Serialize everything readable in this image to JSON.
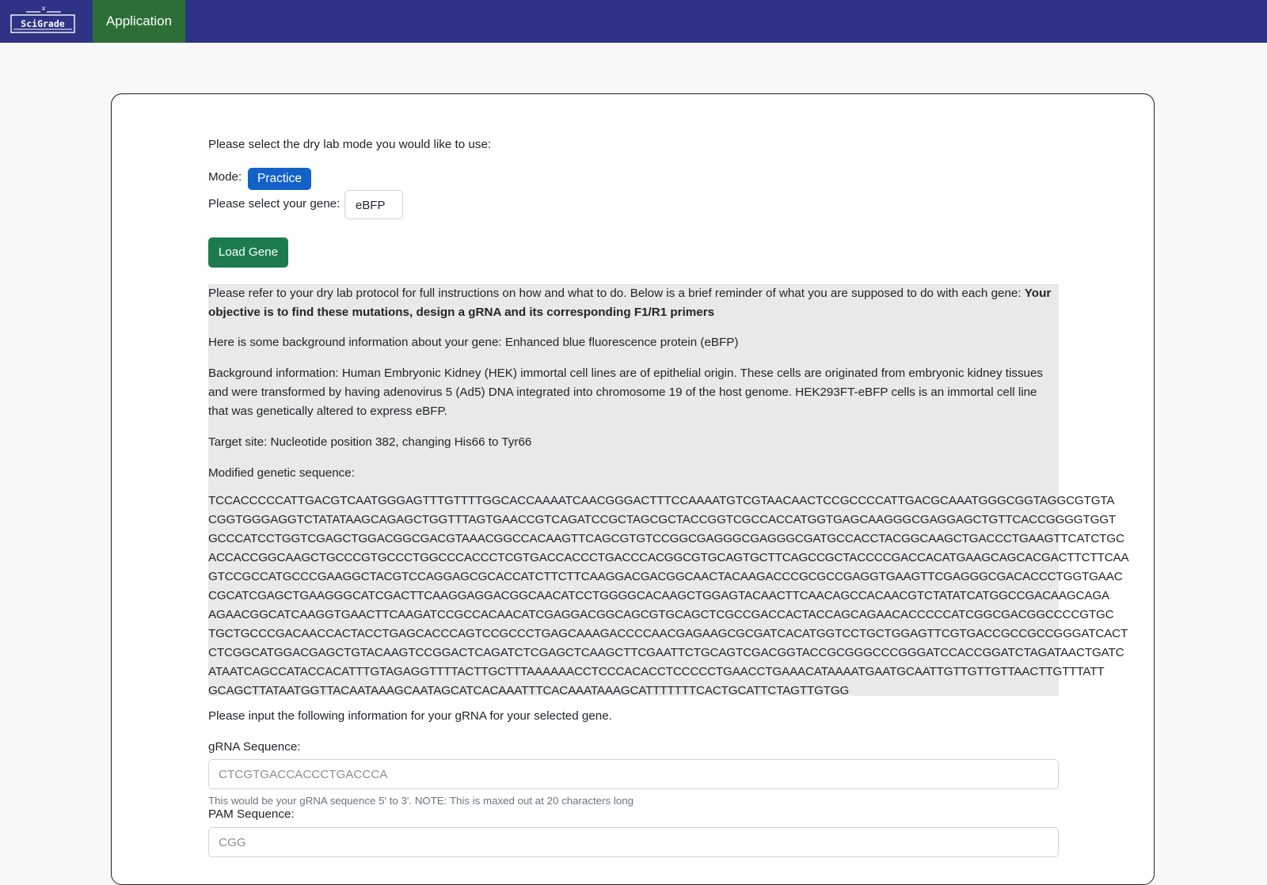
{
  "header": {
    "logo_text": "SciGrade",
    "nav_application": "Application"
  },
  "form": {
    "intro": "Please select the dry lab mode you would like to use:",
    "mode_label": "Mode:",
    "mode_value": "Practice",
    "gene_label": "Please select your gene:",
    "gene_value": "eBFP",
    "load_button": "Load Gene"
  },
  "info": {
    "instructions_prefix": "Please refer to your dry lab protocol for full instructions on how and what to do. Below is a brief reminder of what you are supposed to do with each gene: ",
    "instructions_bold": "Your objective is to find these mutations, design a gRNA and its corresponding F1/R1 primers",
    "background_gene": "Here is some background information about your gene: Enhanced blue fluorescence protein (eBFP)",
    "background_info": "Background information: Human Embryonic Kidney (HEK) immortal cell lines are of epithelial origin. These cells are originated from embryonic kidney tissues and were transformed by having adenovirus 5 (Ad5) DNA integrated into chromosome 19 of the host genome. HEK293FT-eBFP cells is an immortal cell line that was genetically altered to express eBFP.",
    "target_site": "Target site: Nucleotide position 382, changing His66 to Tyr66",
    "sequence_label": "Modified genetic sequence:",
    "sequence_lines": [
      "TCCACCCCCATTGACGTCAATGGGAGTTTGTTTTGGCACCAAAATCAACGGGACTTTCCAAAATGTCGTAACAACTCCGCCCCATTGACGCAAATGGGCGGTAGGCGTGTA",
      "CGGTGGGAGGTCTATATAAGCAGAGCTGGTTTAGTGAACCGTCAGATCCGCTAGCGCTACCGGTCGCCACCATGGTGAGCAAGGGCGAGGAGCTGTTCACCGGGGTGGT",
      "GCCCATCCTGGTCGAGCTGGACGGCGACGTAAACGGCCACAAGTTCAGCGTGTCCGGCGAGGGCGAGGGCGATGCCACCTACGGCAAGCTGACCCTGAAGTTCATCTGC",
      "ACCACCGGCAAGCTGCCCGTGCCCTGGCCCACCCTCGTGACCACCCTGACCCACGGCGTGCAGTGCTTCAGCCGCTACCCCGACCACATGAAGCAGCACGACTTCTTCAA",
      "GTCCGCCATGCCCGAAGGCTACGTCCAGGAGCGCACCATCTTCTTCAAGGACGACGGCAACTACAAGACCCGCGCCGAGGTGAAGTTCGAGGGCGACACCCTGGTGAAC",
      "CGCATCGAGCTGAAGGGCATCGACTTCAAGGAGGACGGCAACATCCTGGGGCACAAGCTGGAGTACAACTTCAACAGCCACAACGTCTATATCATGGCCGACAAGCAGA",
      "AGAACGGCATCAAGGTGAACTTCAAGATCCGCCACAACATCGAGGACGGCAGCGTGCAGCTCGCCGACCACTACCAGCAGAACACCCCCATCGGCGACGGCCCCGTGC",
      "TGCTGCCCGACAACCACTACCTGAGCACCCAGTCCGCCCTGAGCAAAGACCCCAACGAGAAGCGCGATCACATGGTCCTGCTGGAGTTCGTGACCGCCGCCGGGATCACT",
      "CTCGGCATGGACGAGCTGTACAAGTCCGGACTCAGATCTCGAGCTCAAGCTTCGAATTCTGCAGTCGACGGTACCGCGGGCCCGGGATCCACCGGATCTAGATAACTGATC",
      "ATAATCAGCCATACCACATTTGTAGAGGTTTTACTTGCTTTAAAAAACCTCCCACACCTCCCCCTGAACCTGAAACATAAAATGAATGCAATTGTTGTTGTTAACTTGTTTATT",
      "GCAGCTTATAATGGTTACAATAAAGCAATAGCATCACAAATTTCACAAATAAAGCATTTTTTTCACTGCATTCTAGTTGTGG"
    ]
  },
  "grna": {
    "intro": "Please input the following information for your gRNA for your selected gene.",
    "grna_label": "gRNA Sequence:",
    "grna_value": "CTCGTGACCACCCTGACCCA",
    "grna_help": "This would be your gRNA sequence 5' to 3'. NOTE: This is maxed out at 20 characters long",
    "pam_label": "PAM Sequence:",
    "pam_value": "CGG"
  },
  "colors": {
    "navbar": "#2f3386",
    "nav_active": "#2c6e36",
    "practice_button": "#1261c9",
    "load_button": "#1c7c4f",
    "info_background": "#e9e9e9"
  }
}
